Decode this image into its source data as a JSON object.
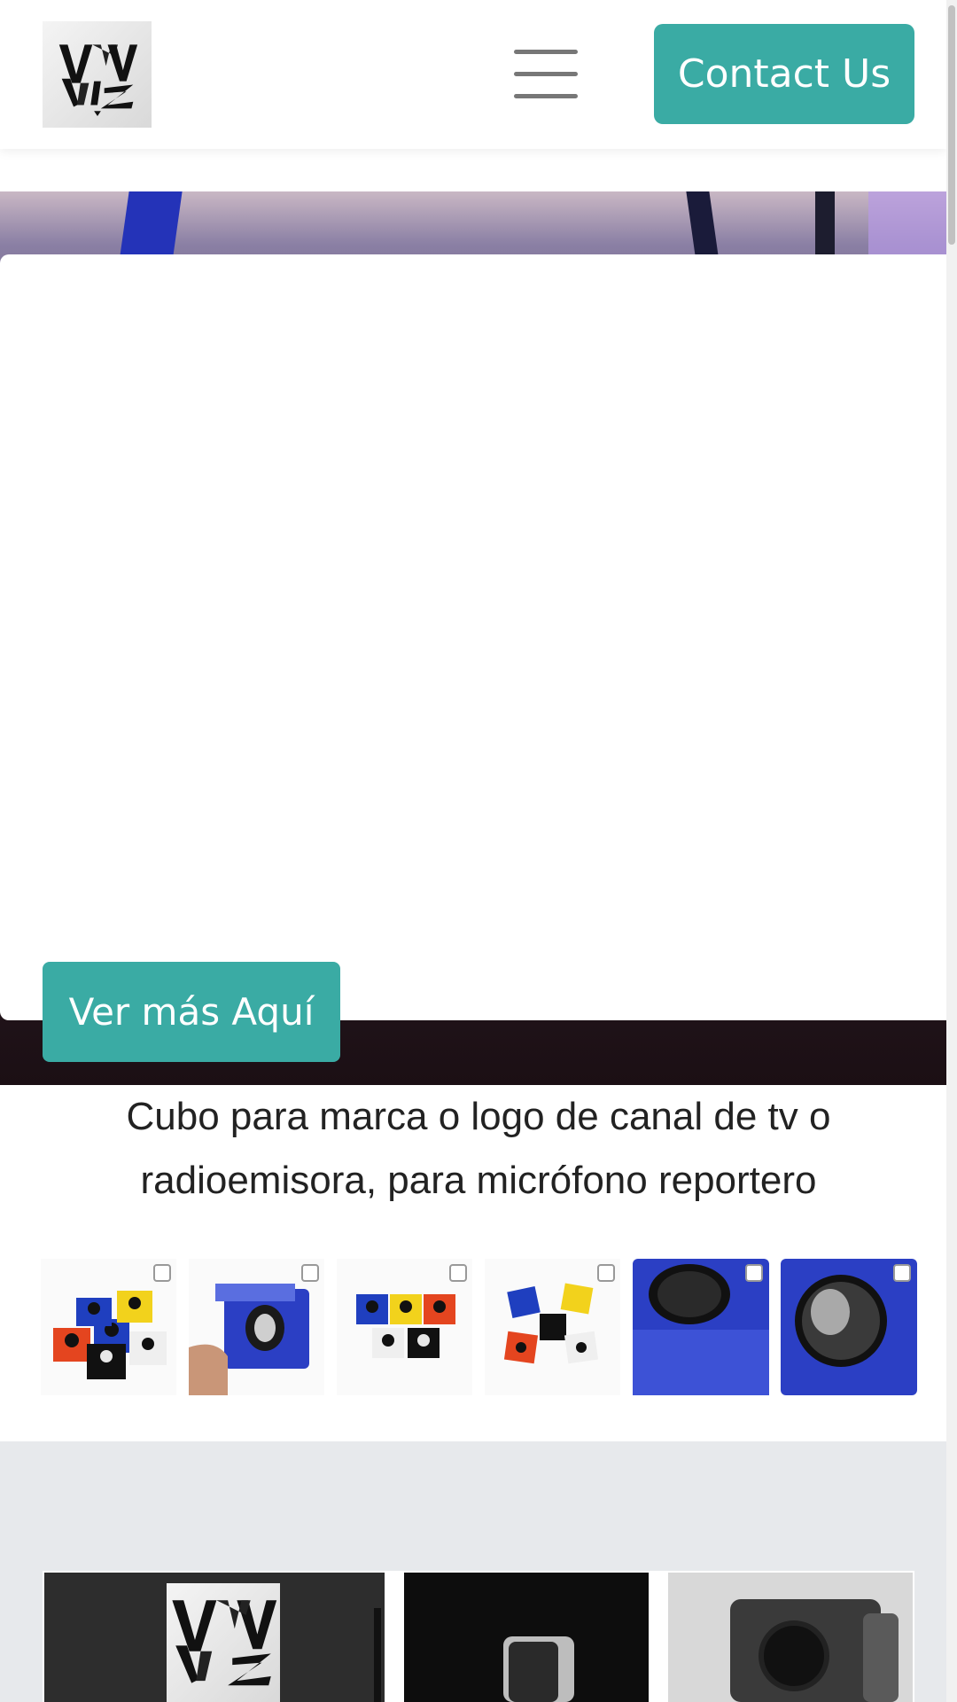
{
  "header": {
    "contact_label": "Contact Us",
    "logo_text": "VNVVLZ"
  },
  "hero": {
    "cta_label": "Ver más Aquí"
  },
  "product": {
    "title_line1": "Cubo para marca o logo de canal de tv o",
    "title_line2": "radioemisora, para micrófono reportero",
    "thumbnails": [
      "cubes-multicolor",
      "blue-cube-hand",
      "cubes-yellow-red",
      "cubes-scattered",
      "blue-cube-top",
      "blue-cube-close"
    ]
  },
  "colors": {
    "accent": "#3aaba4",
    "gallery_bg": "#e7e9ec"
  }
}
